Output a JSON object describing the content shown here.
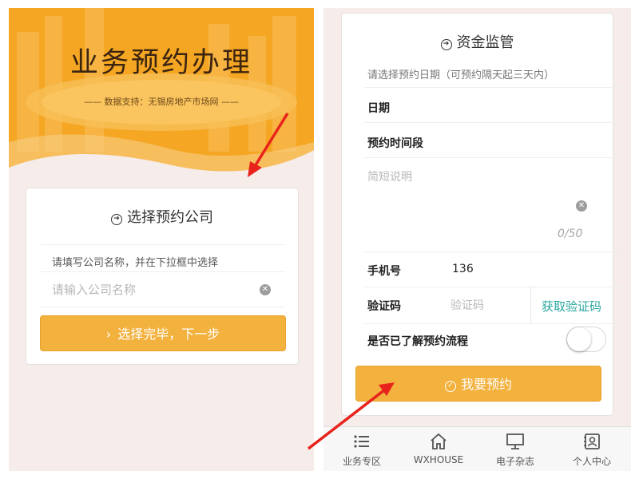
{
  "left": {
    "banner": {
      "title": "业务预约办理",
      "subtitle": "—— 数据支持：无锡房地产市场网 ——"
    },
    "company_card": {
      "title": "选择预约公司",
      "hint": "请填写公司名称，并在下拉框中选择",
      "input_placeholder": "请输入公司名称",
      "input_value": "",
      "next_button": "选择完毕，下一步"
    }
  },
  "right": {
    "form": {
      "title": "资金监管",
      "date_hint": "请选择预约日期（可预约隔天起三天内）",
      "date_label": "日期",
      "time_label": "预约时间段",
      "desc_placeholder": "简短说明",
      "char_counter": "0/50",
      "phone_label": "手机号",
      "phone_value": "136",
      "code_label": "验证码",
      "code_placeholder": "验证码",
      "get_code_button": "获取验证码",
      "process_label": "是否已了解预约流程",
      "process_toggle_on": false,
      "submit_button": "我要预约"
    },
    "tabbar": [
      {
        "label": "业务专区",
        "icon": "list-icon"
      },
      {
        "label": "WXHOUSE",
        "icon": "home-icon"
      },
      {
        "label": "电子杂志",
        "icon": "monitor-icon"
      },
      {
        "label": "个人中心",
        "icon": "contact-card-icon"
      }
    ]
  },
  "colors": {
    "accent_button": "#f3b13e",
    "banner_orange": "#f5a623",
    "link_teal": "#2aa7a0",
    "annotation_red": "#e8231c",
    "page_background": "#f6ecea"
  }
}
